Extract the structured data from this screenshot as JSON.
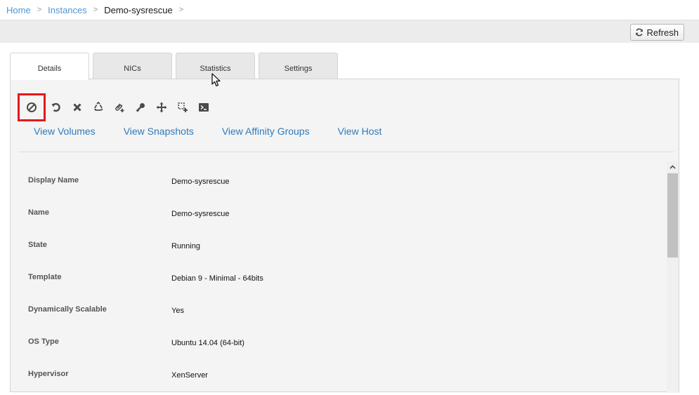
{
  "breadcrumb": {
    "home": "Home",
    "instances": "Instances",
    "current": "Demo-sysrescue",
    "separator": ">"
  },
  "toolbar": {
    "refresh_label": "Refresh"
  },
  "tabs": [
    {
      "label": "Details",
      "active": true
    },
    {
      "label": "NICs",
      "active": false
    },
    {
      "label": "Statistics",
      "active": false
    },
    {
      "label": "Settings",
      "active": false
    }
  ],
  "actions": [
    {
      "icon": "stop-icon",
      "highlighted": true
    },
    {
      "icon": "reboot-icon",
      "highlighted": false
    },
    {
      "icon": "destroy-icon",
      "highlighted": false
    },
    {
      "icon": "reinstall-icon",
      "highlighted": false
    },
    {
      "icon": "attach-iso-icon",
      "highlighted": false
    },
    {
      "icon": "reset-password-icon",
      "highlighted": false
    },
    {
      "icon": "migrate-icon",
      "highlighted": false
    },
    {
      "icon": "change-service-icon",
      "highlighted": false
    },
    {
      "icon": "console-icon",
      "highlighted": false
    }
  ],
  "links": {
    "volumes": "View Volumes",
    "snapshots": "View Snapshots",
    "affinity_groups": "View Affinity Groups",
    "host": "View Host"
  },
  "details": [
    {
      "label": "Display Name",
      "value": "Demo-sysrescue"
    },
    {
      "label": "Name",
      "value": "Demo-sysrescue"
    },
    {
      "label": "State",
      "value": "Running"
    },
    {
      "label": "Template",
      "value": "Debian 9 - Minimal - 64bits"
    },
    {
      "label": "Dynamically Scalable",
      "value": "Yes"
    },
    {
      "label": "OS Type",
      "value": "Ubuntu 14.04 (64-bit)"
    },
    {
      "label": "Hypervisor",
      "value": "XenServer"
    }
  ],
  "colors": {
    "link": "#2d7bbd",
    "highlight": "#e8161b"
  }
}
